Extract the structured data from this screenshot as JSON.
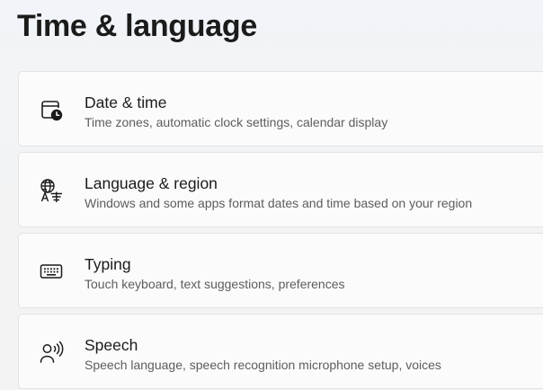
{
  "page": {
    "title": "Time & language"
  },
  "items": [
    {
      "title": "Date & time",
      "description": "Time zones, automatic clock settings, calendar display",
      "icon": "calendar-clock-icon"
    },
    {
      "title": "Language & region",
      "description": "Windows and some apps format dates and time based on your region",
      "icon": "globe-language-icon"
    },
    {
      "title": "Typing",
      "description": "Touch keyboard, text suggestions, preferences",
      "icon": "keyboard-icon"
    },
    {
      "title": "Speech",
      "description": "Speech language, speech recognition microphone setup, voices",
      "icon": "speech-person-icon"
    }
  ]
}
